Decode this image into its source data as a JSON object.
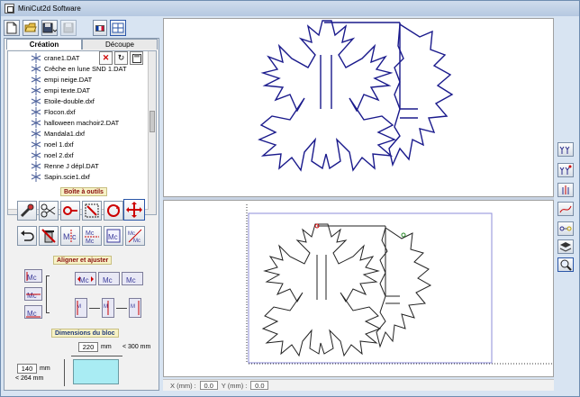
{
  "window": {
    "title": "MiniCut2d Software"
  },
  "tabs": [
    {
      "label": "Création"
    },
    {
      "label": "Découpe"
    }
  ],
  "files": [
    {
      "name": "crane1.DAT"
    },
    {
      "name": "Crêche en lune SND 1.DAT"
    },
    {
      "name": "empi neige.DAT"
    },
    {
      "name": "empi texte.DAT"
    },
    {
      "name": "Etoile-double.dxf"
    },
    {
      "name": "Flocon.dxf"
    },
    {
      "name": "halloween machoir2.DAT"
    },
    {
      "name": "Mandala1.dxf"
    },
    {
      "name": "noel 1.dxf"
    },
    {
      "name": "noel 2.dxf"
    },
    {
      "name": "Renne J dépl.DAT"
    },
    {
      "name": "Sapin.scie1.dxf"
    }
  ],
  "sections": {
    "toolbox": "Boîte à outils",
    "align": "Aligner et ajuster",
    "dimensions": "Dimensions du bloc"
  },
  "dimensions": {
    "width_value": "220",
    "width_unit": "mm",
    "width_max": "< 300 mm",
    "height_value": "140",
    "height_unit": "mm",
    "height_max": "< 264 mm"
  },
  "status": {
    "x_label": "X (mm) :",
    "x_value": "0.0",
    "y_label": "Y (mm) :",
    "y_value": "0.0"
  },
  "colors": {
    "top_drawing": "#1a1a8c",
    "bottom_drawing": "#222222",
    "work_area_border": "#8c8cd8",
    "preview_fill": "#a9ecf3",
    "section_label_text": "#8a0f0f"
  },
  "icons": {
    "toolbar": [
      "new-file-icon",
      "open-folder-icon",
      "save-icon",
      "disk-icon",
      "french-flag-icon",
      "layout-icon"
    ],
    "tools": [
      "measure-icon",
      "scissors-icon",
      "node-icon",
      "resize-icon",
      "rotate-icon",
      "move-icon",
      "undo-icon",
      "delete-icon",
      "mirror-h-icon",
      "mirror-v-icon",
      "group-icon",
      "ungroup-icon",
      "array-icon"
    ],
    "right": [
      "tree-add-icon",
      "tree-duplicate-icon",
      "tree-split-icon",
      "curve-icon",
      "path-icon",
      "layers-icon",
      "zoom-icon"
    ]
  }
}
